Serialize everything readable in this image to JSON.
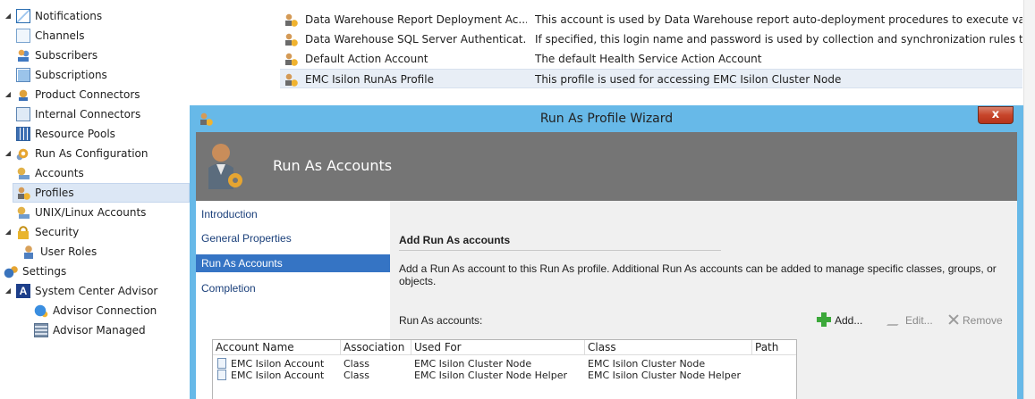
{
  "tree": {
    "items": [
      {
        "label": "Notifications",
        "expanded": true,
        "icon": "mail-icon"
      },
      {
        "label": "Channels",
        "icon": "channels-icon"
      },
      {
        "label": "Subscribers",
        "icon": "subscribers-icon"
      },
      {
        "label": "Subscriptions",
        "icon": "subscriptions-icon"
      },
      {
        "label": "Product Connectors",
        "expanded": true,
        "icon": "connector-icon"
      },
      {
        "label": "Internal Connectors",
        "icon": "internal-connector-icon"
      },
      {
        "label": "Resource Pools",
        "icon": "resource-pool-icon"
      },
      {
        "label": "Run As Configuration",
        "expanded": true,
        "icon": "run-as-gear-icon"
      },
      {
        "label": "Accounts",
        "icon": "accounts-icon"
      },
      {
        "label": "Profiles",
        "selected": true,
        "icon": "profiles-icon"
      },
      {
        "label": "UNIX/Linux Accounts",
        "icon": "unix-accounts-icon"
      },
      {
        "label": "Security",
        "expanded": true,
        "icon": "lock-icon"
      },
      {
        "label": "User Roles",
        "icon": "user-roles-icon"
      },
      {
        "label": "Settings",
        "icon": "settings-icon"
      },
      {
        "label": "System Center Advisor",
        "expanded": true,
        "icon": "advisor-icon"
      },
      {
        "label": "Advisor Connection",
        "icon": "advisor-connection-icon"
      },
      {
        "label": "Advisor Managed",
        "icon": "advisor-managed-icon"
      }
    ]
  },
  "profiles_list": {
    "rows": [
      {
        "name": "Data Warehouse Report Deployment Ac...",
        "description": "This account is used by Data Warehouse report auto-deployment procedures to execute vario"
      },
      {
        "name": "Data Warehouse SQL Server Authenticat...",
        "description": "If specified, this login name and password is used by collection and synchronization rules to c"
      },
      {
        "name": "Default Action Account",
        "description": "The default Health Service Action Account"
      },
      {
        "name": "EMC Isilon RunAs Profile",
        "description": "This profile is used for accessing EMC Isilon Cluster Node",
        "selected": true
      }
    ]
  },
  "wizard": {
    "title": "Run As Profile Wizard",
    "close_label": "x",
    "header_title": "Run As Accounts",
    "steps": [
      {
        "label": "Introduction"
      },
      {
        "label": "General Properties"
      },
      {
        "label": "Run As Accounts",
        "active": true
      },
      {
        "label": "Completion"
      }
    ],
    "section_title": "Add Run As accounts",
    "description": "Add a Run As account to this Run As profile.  Additional Run As accounts can be added to manage specific classes, groups, or objects.",
    "list_label": "Run As accounts:",
    "toolbar": {
      "add_label": "Add...",
      "edit_label": "Edit...",
      "remove_label": "Remove"
    },
    "table": {
      "columns": [
        "Account Name",
        "Association",
        "Used For",
        "Class",
        "Path"
      ],
      "rows": [
        [
          "EMC Isilon Account",
          "Class",
          "EMC Isilon Cluster Node",
          "EMC Isilon Cluster Node",
          ""
        ],
        [
          "EMC Isilon Account",
          "Class",
          "EMC Isilon Cluster Node Helper",
          "EMC Isilon Cluster Node Helper",
          ""
        ]
      ]
    }
  },
  "colors": {
    "titlebar": "#67b9e8",
    "header": "#757575",
    "active_step": "#3574c4",
    "close_button": "#c7452a",
    "selected_tree_item": "#dce7f5"
  }
}
